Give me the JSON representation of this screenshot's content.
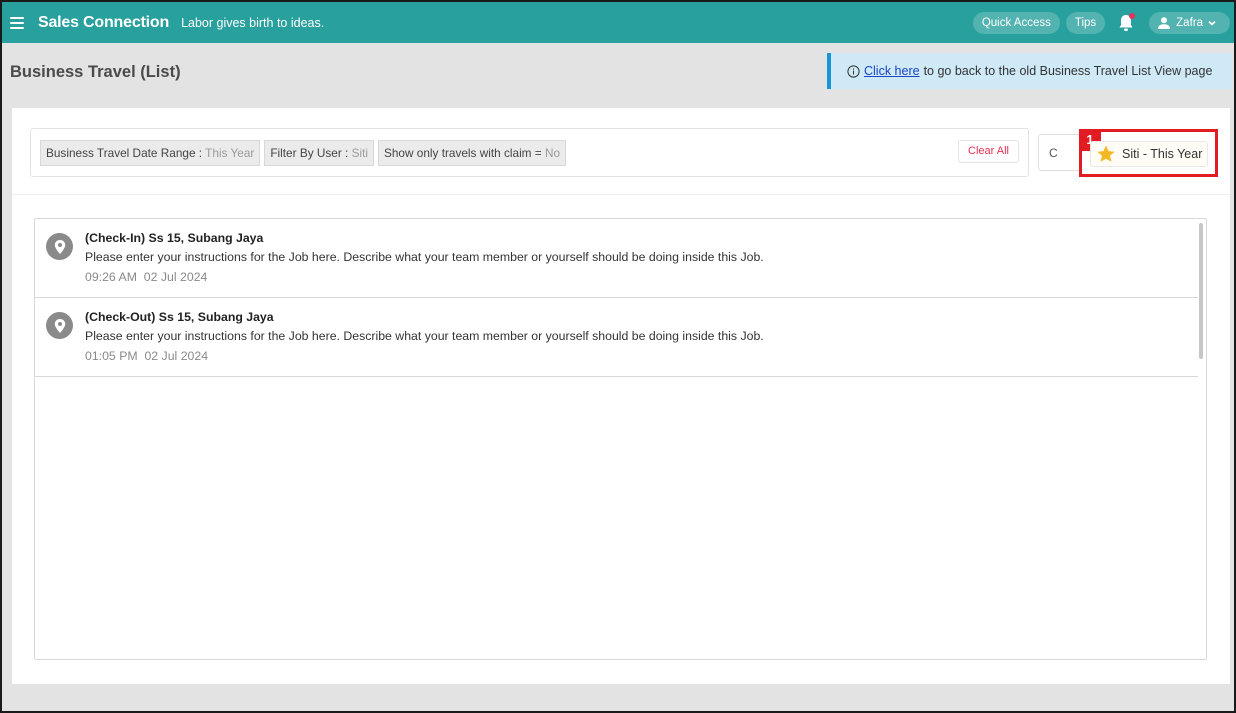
{
  "topbar": {
    "brand": "Sales Connection",
    "tagline": "Labor gives birth to ideas.",
    "quick_access": "Quick Access",
    "tips": "Tips",
    "user_name": "Zafra"
  },
  "header": {
    "title": "Business Travel (List)",
    "notice_link": "Click here",
    "notice_text": "to go back to the old Business Travel List View page"
  },
  "filters": [
    {
      "label": "Business Travel Date Range :",
      "value": "This Year"
    },
    {
      "label": "Filter By User :",
      "value": "Siti"
    },
    {
      "label": "Show only travels with claim =",
      "value": "No"
    }
  ],
  "clear_all": "Clear All",
  "hidden_button_label": "C",
  "saved_filter": {
    "badge": "1",
    "label": "Siti - This Year"
  },
  "entries": [
    {
      "title": "(Check-In) Ss 15, Subang Jaya",
      "description": "Please enter your instructions for the Job here. Describe what your team member or yourself should be doing inside this Job.",
      "time": "09:26 AM  02 Jul 2024"
    },
    {
      "title": "(Check-Out) Ss 15, Subang Jaya",
      "description": "Please enter your instructions for the Job here. Describe what your team member or yourself should be doing inside this Job.",
      "time": "01:05 PM  02 Jul 2024"
    }
  ],
  "colors": {
    "topbar": "#28a09e",
    "highlight": "#e31b23",
    "clear": "#e03050",
    "star": "#f5b825"
  }
}
